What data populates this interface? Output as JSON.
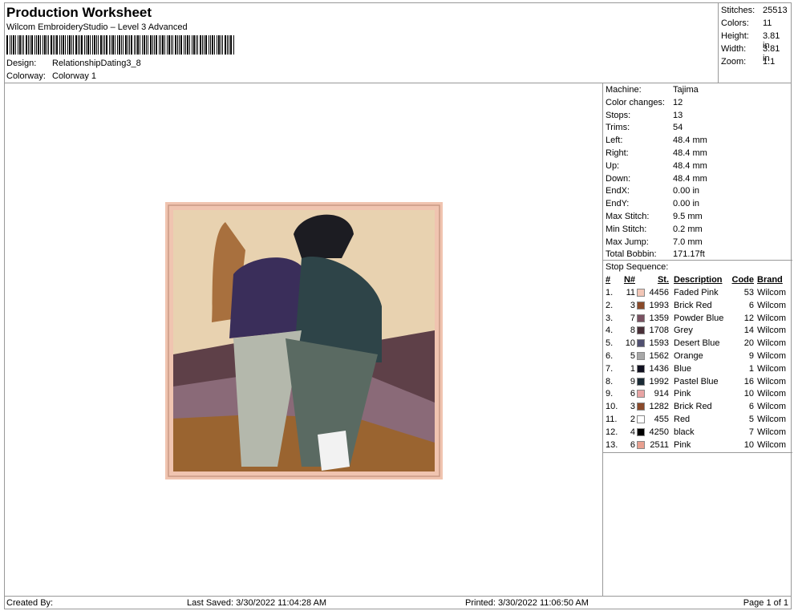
{
  "header": {
    "title": "Production Worksheet",
    "subtitle": "Wilcom EmbroideryStudio – Level 3 Advanced",
    "design_label": "Design:",
    "design_value": "RelationshipDating3_8",
    "colorway_label": "Colorway:",
    "colorway_value": "Colorway 1"
  },
  "summary": [
    {
      "k": "Stitches:",
      "v": "25513"
    },
    {
      "k": "Colors:",
      "v": "11"
    },
    {
      "k": "Height:",
      "v": "3.81 in"
    },
    {
      "k": "Width:",
      "v": "3.81 in"
    },
    {
      "k": "Zoom:",
      "v": "1:1"
    }
  ],
  "machine": [
    {
      "k": "Machine:",
      "v": "Tajima"
    },
    {
      "k": "Color changes:",
      "v": "12"
    },
    {
      "k": "Stops:",
      "v": "13"
    },
    {
      "k": "Trims:",
      "v": "54"
    },
    {
      "k": "Left:",
      "v": "48.4 mm"
    },
    {
      "k": "Right:",
      "v": "48.4 mm"
    },
    {
      "k": "Up:",
      "v": "48.4 mm"
    },
    {
      "k": "Down:",
      "v": "48.4 mm"
    },
    {
      "k": "EndX:",
      "v": "0.00 in"
    },
    {
      "k": "EndY:",
      "v": "0.00 in"
    },
    {
      "k": "Max Stitch:",
      "v": "9.5 mm"
    },
    {
      "k": "Min Stitch:",
      "v": "0.2 mm"
    },
    {
      "k": "Max Jump:",
      "v": "7.0 mm"
    },
    {
      "k": "Total Bobbin:",
      "v": "171.17ft"
    }
  ],
  "stop_sequence_label": "Stop Sequence:",
  "table_headers": [
    "#",
    "N#",
    "St.",
    "Description",
    "Code",
    "Brand"
  ],
  "stops": [
    {
      "n": "1.",
      "nn": "11",
      "color": "#f2c6b6",
      "st": "4456",
      "desc": "Faded Pink",
      "code": "53",
      "brand": "Wilcom"
    },
    {
      "n": "2.",
      "nn": "3",
      "color": "#8a4a2a",
      "st": "1993",
      "desc": "Brick Red",
      "code": "6",
      "brand": "Wilcom"
    },
    {
      "n": "3.",
      "nn": "7",
      "color": "#7a5262",
      "st": "1359",
      "desc": "Powder Blue",
      "code": "12",
      "brand": "Wilcom"
    },
    {
      "n": "4.",
      "nn": "8",
      "color": "#4a3038",
      "st": "1708",
      "desc": "Grey",
      "code": "14",
      "brand": "Wilcom"
    },
    {
      "n": "5.",
      "nn": "10",
      "color": "#505070",
      "st": "1593",
      "desc": "Desert Blue",
      "code": "20",
      "brand": "Wilcom"
    },
    {
      "n": "6.",
      "nn": "5",
      "color": "#a8a8a8",
      "st": "1562",
      "desc": "Orange",
      "code": "9",
      "brand": "Wilcom"
    },
    {
      "n": "7.",
      "nn": "1",
      "color": "#101020",
      "st": "1436",
      "desc": "Blue",
      "code": "1",
      "brand": "Wilcom"
    },
    {
      "n": "8.",
      "nn": "9",
      "color": "#1a2a36",
      "st": "1992",
      "desc": "Pastel Blue",
      "code": "16",
      "brand": "Wilcom"
    },
    {
      "n": "9.",
      "nn": "6",
      "color": "#e8a4a4",
      "st": "914",
      "desc": "Pink",
      "code": "10",
      "brand": "Wilcom"
    },
    {
      "n": "10.",
      "nn": "3",
      "color": "#8a4a2a",
      "st": "1282",
      "desc": "Brick Red",
      "code": "6",
      "brand": "Wilcom"
    },
    {
      "n": "11.",
      "nn": "2",
      "color": "#ffffff",
      "st": "455",
      "desc": "Red",
      "code": "5",
      "brand": "Wilcom"
    },
    {
      "n": "12.",
      "nn": "4",
      "color": "#000000",
      "st": "4250",
      "desc": "black",
      "code": "7",
      "brand": "Wilcom"
    },
    {
      "n": "13.",
      "nn": "6",
      "color": "#e8a090",
      "st": "2511",
      "desc": "Pink",
      "code": "10",
      "brand": "Wilcom"
    }
  ],
  "footer": {
    "created": "Created By:",
    "saved": "Last Saved: 3/30/2022 11:04:28 AM",
    "printed": "Printed: 3/30/2022 11:06:50 AM",
    "page": "Page 1 of 1"
  }
}
